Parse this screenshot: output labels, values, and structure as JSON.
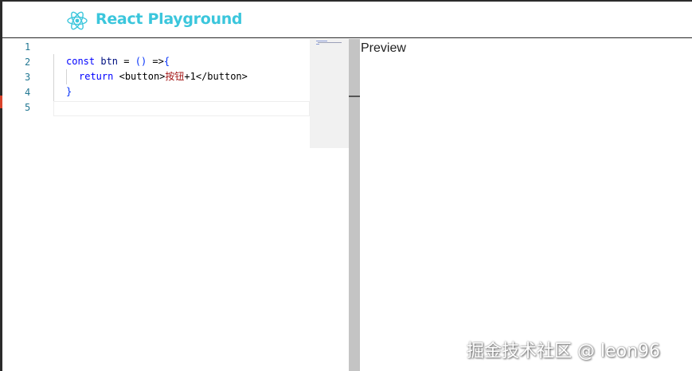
{
  "header": {
    "title": "React Playground",
    "logo_icon": "react-atom-icon",
    "accent": "#3bc6dc"
  },
  "editor": {
    "line_numbers": [
      "1",
      "2",
      "3",
      "4",
      "5"
    ],
    "lines": {
      "l2": {
        "kw": "const",
        "id": "btn",
        "eq": " = ",
        "paren": "()",
        "arrow": " =>",
        "brace": "{"
      },
      "l3": {
        "kw": "return",
        "tag_open": "<button>",
        "text": "按钮",
        "plus": "+1",
        "tag_close": "</button>"
      },
      "l4": {
        "brace": "}"
      }
    }
  },
  "preview": {
    "label": "Preview"
  },
  "watermark": {
    "text": "掘金技术社区 @ leon96"
  }
}
